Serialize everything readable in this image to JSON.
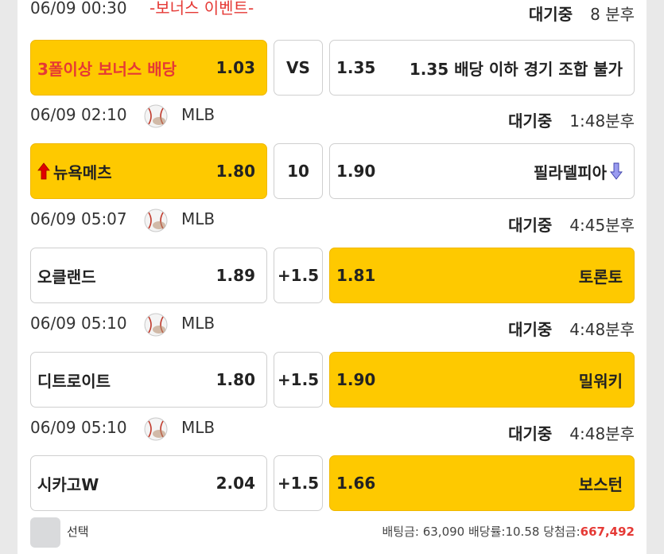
{
  "event": {
    "time": "06/09 00:30",
    "label": "-보너스 이벤트-",
    "status_word": "대기중",
    "status_time": "8 분후",
    "home": {
      "name": "3폴이상 보너스 배당",
      "odds": "1.03"
    },
    "mid": "VS",
    "away": {
      "odds": "1.35",
      "name": "1.35 배당 이하 경기 조합 불가"
    }
  },
  "games": [
    {
      "time": "06/09 02:10",
      "league": "MLB",
      "ball_icon": "baseball-icon",
      "status_word": "대기중",
      "status_time": "1:48분후",
      "home": {
        "name": "뉴욕메츠",
        "odds": "1.80",
        "selected": true,
        "trend": "up"
      },
      "mid": "10",
      "away": {
        "odds": "1.90",
        "name": "필라델피아",
        "selected": false,
        "trend": "down"
      }
    },
    {
      "time": "06/09 05:07",
      "league": "MLB",
      "ball_icon": "baseball-icon",
      "status_word": "대기중",
      "status_time": "4:45분후",
      "home": {
        "name": "오클랜드",
        "odds": "1.89",
        "selected": false
      },
      "mid": "+1.5",
      "away": {
        "odds": "1.81",
        "name": "토론토",
        "selected": true
      }
    },
    {
      "time": "06/09 05:10",
      "league": "MLB",
      "ball_icon": "baseball-icon",
      "status_word": "대기중",
      "status_time": "4:48분후",
      "home": {
        "name": "디트로이트",
        "odds": "1.80",
        "selected": false
      },
      "mid": "+1.5",
      "away": {
        "odds": "1.90",
        "name": "밀워키",
        "selected": true
      }
    },
    {
      "time": "06/09 05:10",
      "league": "MLB",
      "ball_icon": "baseball-icon",
      "status_word": "대기중",
      "status_time": "4:48분후",
      "home": {
        "name": "시카고W",
        "odds": "2.04",
        "selected": false
      },
      "mid": "+1.5",
      "away": {
        "odds": "1.66",
        "name": "보스턴",
        "selected": true
      }
    }
  ],
  "footer": {
    "select_label": "선택",
    "bet_label": "배팅금:",
    "bet_amount": "63,090",
    "rate_label": "배당률:",
    "rate_value": "10.58",
    "win_label": "당첨금:",
    "win_amount": "667,492"
  },
  "colors": {
    "selected": "#fec900",
    "accent_red": "#e53935",
    "trend_up": "#e00000",
    "trend_down": "#7b7fe0"
  }
}
